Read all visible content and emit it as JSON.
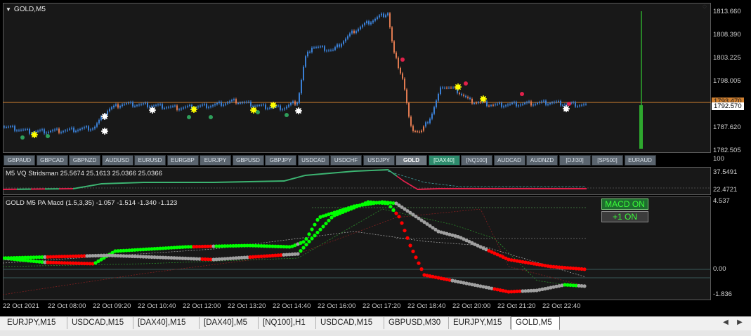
{
  "chart": {
    "title": "GOLD,M5",
    "price_ticks": [
      "1813.660",
      "1808.390",
      "1803.225",
      "1798.005",
      "1792.570",
      "1787.620",
      "1782.505"
    ],
    "price_tag_orange": "1793.470",
    "price_tag_current": "1792.570"
  },
  "symbol_buttons": [
    "GBPAUD",
    "GBPCAD",
    "GBPNZD",
    "AUDUSD",
    "EURUSD",
    "EURGBP",
    "EURJPY",
    "GBPUSD",
    "GBPJPY",
    "USDCAD",
    "USDCHF",
    "USDJPY",
    "GOLD",
    "[DAX40]",
    "[NQ100]",
    "AUDCAD",
    "AUDNZD",
    "[DJI30]",
    "[SP500]",
    "EURAUD"
  ],
  "vq_pane": {
    "label": "M5 VQ Stridsman 25.5674 25.1613 25.0366 25.0366",
    "ticks": [
      "100",
      "37.5491",
      "22.4721"
    ]
  },
  "macd_pane": {
    "label": "GOLD M5 PA Macd (1.5,3,35) -1.057 -1.514 -1.340 -1.123",
    "ticks": [
      "4.537",
      "0.00",
      "-1.836"
    ],
    "macd_button": "MACD ON",
    "plus_button": "+1 ON"
  },
  "time_labels": [
    "22 Oct 2021",
    "22 Oct 08:00",
    "22 Oct 09:20",
    "22 Oct 10:40",
    "22 Oct 12:00",
    "22 Oct 13:20",
    "22 Oct 14:40",
    "22 Oct 16:00",
    "22 Oct 17:20",
    "22 Oct 18:40",
    "22 Oct 20:00",
    "22 Oct 21:20",
    "22 Oct 22:40"
  ],
  "tabs": [
    "EURJPY,M15",
    "USDCAD,M15",
    "[DAX40],M15",
    "[DAX40],M5",
    "[NQ100],H1",
    "USDCAD,M15",
    "GBPUSD,M30",
    "EURJPY,M15",
    "GOLD,M5"
  ],
  "active_tab": "GOLD,M5",
  "colors": {
    "bull_candle": "#3a7fd5",
    "bear_candle": "#e07a50",
    "orange_line": "#d08030",
    "macd_green": "#00ff00",
    "macd_gray": "#a0a0a0",
    "macd_red": "#ff0000",
    "vq_green": "#3cb371",
    "vq_red": "#e0204a"
  }
}
